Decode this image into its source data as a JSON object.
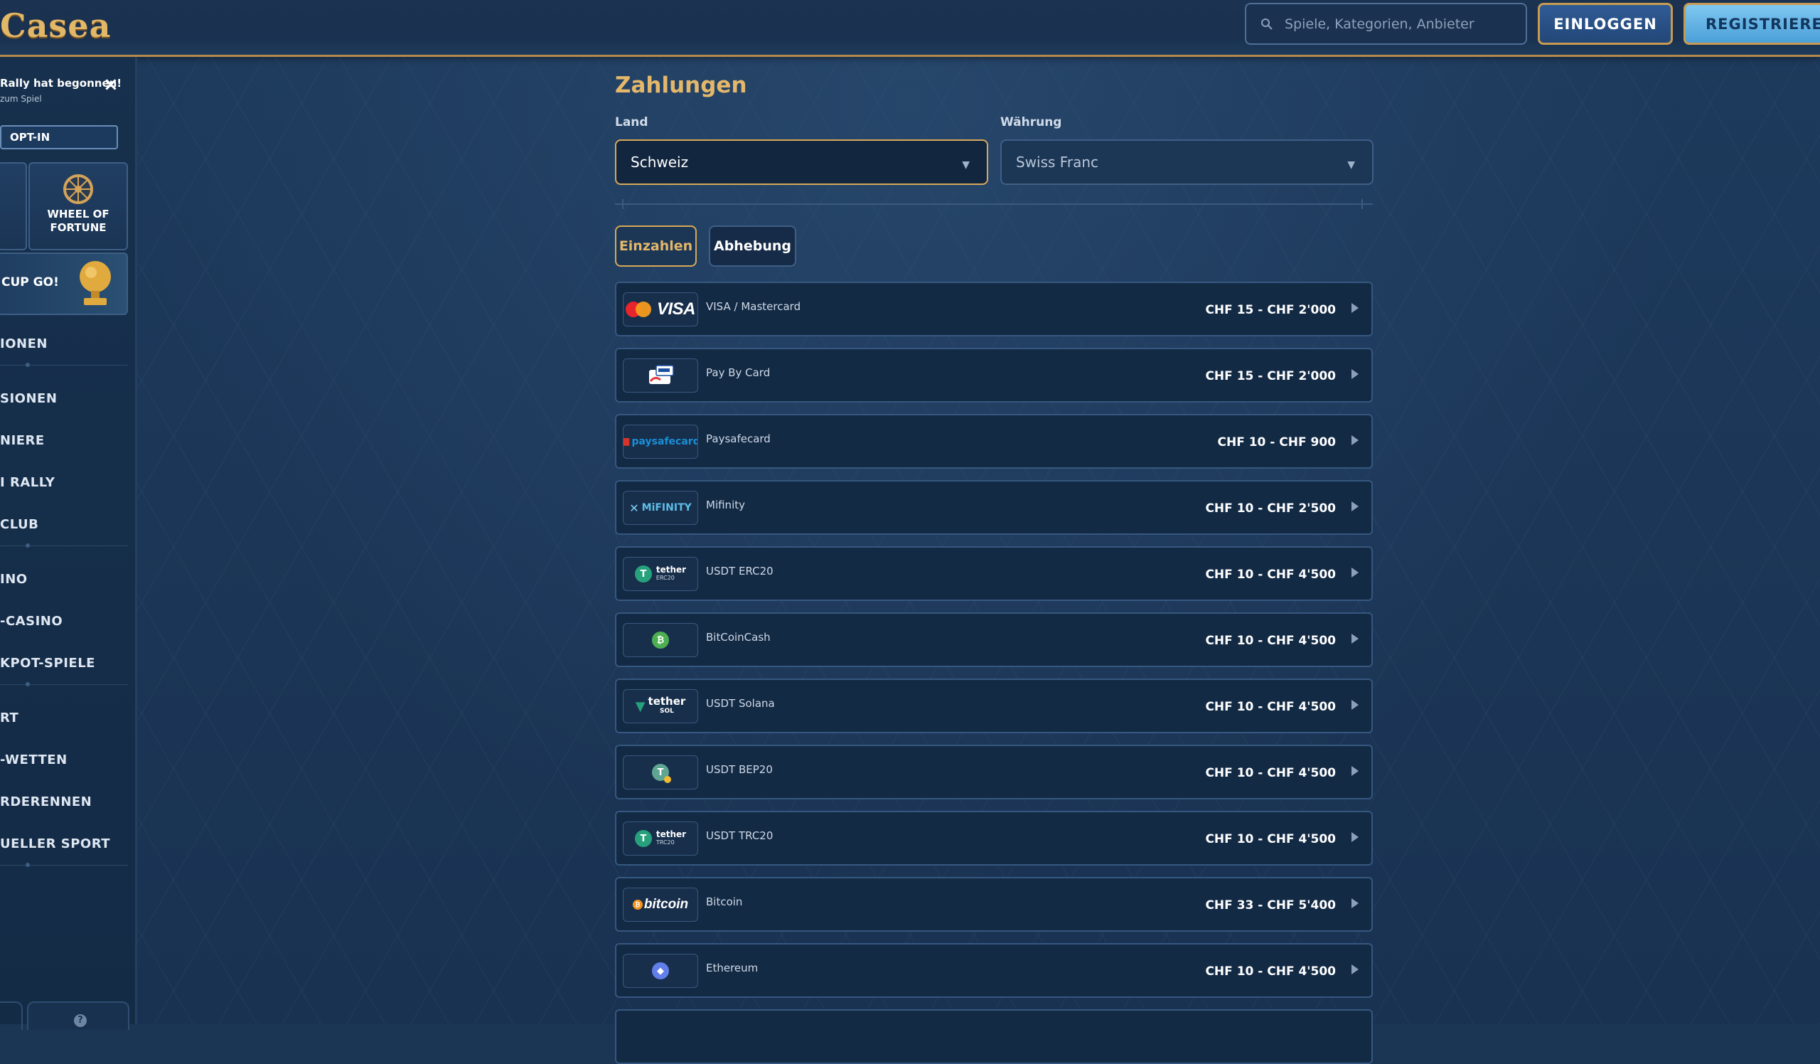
{
  "header": {
    "logo_text": "Casea",
    "search_placeholder": "Spiele, Kategorien, Anbieter",
    "login_label": "EINLOGGEN",
    "register_label": "REGISTRIEREN"
  },
  "sidebar": {
    "rally_title": "Rally hat begonnen!",
    "rally_sub": "zum Spiel",
    "optin_label": "OPT-IN",
    "wheel_label": "WHEEL OF FORTUNE",
    "cup_label": "CUP GO!",
    "nav": [
      "IONEN",
      "SIONEN",
      "NIERE",
      "I RALLY",
      "CLUB",
      "INO",
      "-CASINO",
      "KPOT-SPIELE",
      "RT",
      "-WETTEN",
      "RDERENNEN",
      "UELLER SPORT"
    ]
  },
  "payments": {
    "title": "Zahlungen",
    "country_label": "Land",
    "country_value": "Schweiz",
    "currency_label": "Währung",
    "currency_value": "Swiss Franc",
    "tab_deposit": "Einzahlen",
    "tab_withdraw": "Abhebung",
    "methods": [
      {
        "name": "VISA / Mastercard",
        "range": "CHF 15 - CHF 2'000",
        "logo": "visa-mastercard"
      },
      {
        "name": "Pay By Card",
        "range": "CHF 15 - CHF 2'000",
        "logo": "pay-by-card"
      },
      {
        "name": "Paysafecard",
        "range": "CHF 10 - CHF 900",
        "logo": "paysafecard",
        "logo_text": "paysafecard"
      },
      {
        "name": "Mifinity",
        "range": "CHF 10 - CHF 2'500",
        "logo": "mifinity",
        "logo_text": "MiFINITY"
      },
      {
        "name": "USDT ERC20",
        "range": "CHF 10 - CHF 4'500",
        "logo": "tether-erc20",
        "logo_text": "tether",
        "logo_sub": "ERC20"
      },
      {
        "name": "BitCoinCash",
        "range": "CHF 10 - CHF 4'500",
        "logo": "bitcoincash"
      },
      {
        "name": "USDT Solana",
        "range": "CHF 10 - CHF 4'500",
        "logo": "tether-sol",
        "logo_text": "tether",
        "logo_sub": "SOL"
      },
      {
        "name": "USDT BEP20",
        "range": "CHF 10 - CHF 4'500",
        "logo": "tether-bep20"
      },
      {
        "name": "USDT TRC20",
        "range": "CHF 10 - CHF 4'500",
        "logo": "tether-trc20",
        "logo_text": "tether",
        "logo_sub": "TRC20"
      },
      {
        "name": "Bitcoin",
        "range": "CHF 33 - CHF 5'400",
        "logo": "bitcoin",
        "logo_text": "bitcoin"
      },
      {
        "name": "Ethereum",
        "range": "CHF 10 - CHF 4'500",
        "logo": "ethereum"
      }
    ]
  },
  "colors": {
    "gold": "#e4b76a",
    "background": "#1b3554",
    "card": "#132a45",
    "register_bg": "#5fb2e3"
  }
}
